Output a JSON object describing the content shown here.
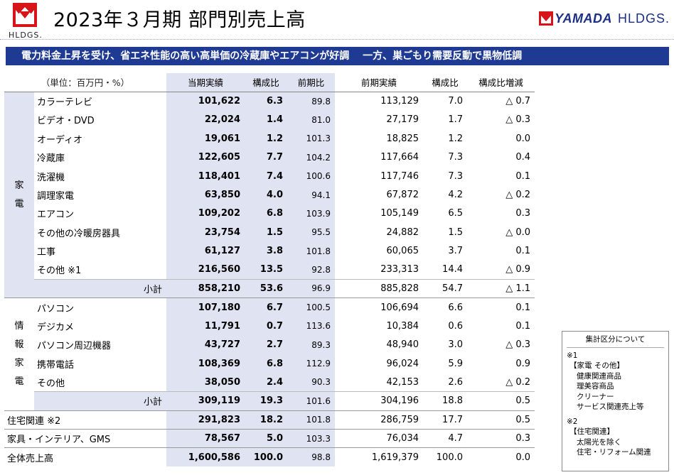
{
  "header": {
    "logo_left_text": "HLDGS.",
    "title": "2023年３月期 部門別売上高",
    "brand_mark": "YAMADA",
    "brand_suffix": "HLDGS."
  },
  "banner": "電力料金上昇を受け、省エネ性能の高い高単価の冷蔵庫やエアコンが好調　 一方、巣ごもり需要反動で黒物低調",
  "table": {
    "unit_label": "（単位：百万円・%）",
    "columns": [
      "当期実績",
      "構成比",
      "前期比",
      "前期実績",
      "構成比",
      "構成比増減"
    ],
    "groups": [
      {
        "label": "家\n電",
        "rows": [
          {
            "name": "カラーテレビ",
            "cur": "101,622",
            "ratio": "6.3",
            "yoy": "89.8",
            "prev": "113,129",
            "pratio": "7.0",
            "chg": "△ 0.7"
          },
          {
            "name": "ビデオ・DVD",
            "cur": "22,024",
            "ratio": "1.4",
            "yoy": "81.0",
            "prev": "27,179",
            "pratio": "1.7",
            "chg": "△ 0.3"
          },
          {
            "name": "オーディオ",
            "cur": "19,061",
            "ratio": "1.2",
            "yoy": "101.3",
            "prev": "18,825",
            "pratio": "1.2",
            "chg": "0.0"
          },
          {
            "name": "冷蔵庫",
            "cur": "122,605",
            "ratio": "7.7",
            "yoy": "104.2",
            "prev": "117,664",
            "pratio": "7.3",
            "chg": "0.4"
          },
          {
            "name": "洗濯機",
            "cur": "118,401",
            "ratio": "7.4",
            "yoy": "100.6",
            "prev": "117,746",
            "pratio": "7.3",
            "chg": "0.1"
          },
          {
            "name": "調理家電",
            "cur": "63,850",
            "ratio": "4.0",
            "yoy": "94.1",
            "prev": "67,872",
            "pratio": "4.2",
            "chg": "△ 0.2"
          },
          {
            "name": "エアコン",
            "cur": "109,202",
            "ratio": "6.8",
            "yoy": "103.9",
            "prev": "105,149",
            "pratio": "6.5",
            "chg": "0.3"
          },
          {
            "name": "その他の冷暖房器具",
            "cur": "23,754",
            "ratio": "1.5",
            "yoy": "95.5",
            "prev": "24,882",
            "pratio": "1.5",
            "chg": "△ 0.0"
          },
          {
            "name": "工事",
            "cur": "61,127",
            "ratio": "3.8",
            "yoy": "101.8",
            "prev": "60,065",
            "pratio": "3.7",
            "chg": "0.1"
          },
          {
            "name": "その他 ※1",
            "cur": "216,560",
            "ratio": "13.5",
            "yoy": "92.8",
            "prev": "233,313",
            "pratio": "14.4",
            "chg": "△ 0.9"
          }
        ],
        "subtotal": {
          "name": "小計",
          "cur": "858,210",
          "ratio": "53.6",
          "yoy": "96.9",
          "prev": "885,828",
          "pratio": "54.7",
          "chg": "△ 1.1"
        }
      },
      {
        "label": "情\n報\n家\n電",
        "rows": [
          {
            "name": "パソコン",
            "cur": "107,180",
            "ratio": "6.7",
            "yoy": "100.5",
            "prev": "106,694",
            "pratio": "6.6",
            "chg": "0.1"
          },
          {
            "name": "デジカメ",
            "cur": "11,791",
            "ratio": "0.7",
            "yoy": "113.6",
            "prev": "10,384",
            "pratio": "0.6",
            "chg": "0.1"
          },
          {
            "name": "パソコン周辺機器",
            "cur": "43,727",
            "ratio": "2.7",
            "yoy": "89.3",
            "prev": "48,940",
            "pratio": "3.0",
            "chg": "△ 0.3"
          },
          {
            "name": "携帯電話",
            "cur": "108,369",
            "ratio": "6.8",
            "yoy": "112.9",
            "prev": "96,024",
            "pratio": "5.9",
            "chg": "0.9"
          },
          {
            "name": "その他",
            "cur": "38,050",
            "ratio": "2.4",
            "yoy": "90.3",
            "prev": "42,153",
            "pratio": "2.6",
            "chg": "△ 0.2"
          }
        ],
        "subtotal": {
          "name": "小計",
          "cur": "309,119",
          "ratio": "19.3",
          "yoy": "101.6",
          "prev": "304,196",
          "pratio": "18.8",
          "chg": "0.5"
        }
      }
    ],
    "extra_rows": [
      {
        "name": "住宅関連 ※2",
        "cur": "291,823",
        "ratio": "18.2",
        "yoy": "101.8",
        "prev": "286,759",
        "pratio": "17.7",
        "chg": "0.5"
      },
      {
        "name": "家具・インテリア、GMS",
        "cur": "78,567",
        "ratio": "5.0",
        "yoy": "103.3",
        "prev": "76,034",
        "pratio": "4.7",
        "chg": "0.3"
      },
      {
        "name": "全体売上高",
        "cur": "1,600,586",
        "ratio": "100.0",
        "yoy": "98.8",
        "prev": "1,619,379",
        "pratio": "100.0",
        "chg": "0.0"
      }
    ]
  },
  "legend": {
    "title": "集計区分について",
    "note1_mark": "※1",
    "note1_head": "【家電 その他】",
    "note1_items": [
      "健康関連商品",
      "理美容商品",
      "クリーナー",
      "サービス関連売上等"
    ],
    "note2_mark": "※2",
    "note2_head": "【住宅関連】",
    "note2_items": [
      "太陽光を除く",
      "住宅・リフォーム関連"
    ]
  },
  "colors": {
    "brand_red": "#d7141a",
    "brand_navy": "#1f3a93",
    "shade": "#dfe3f2"
  }
}
